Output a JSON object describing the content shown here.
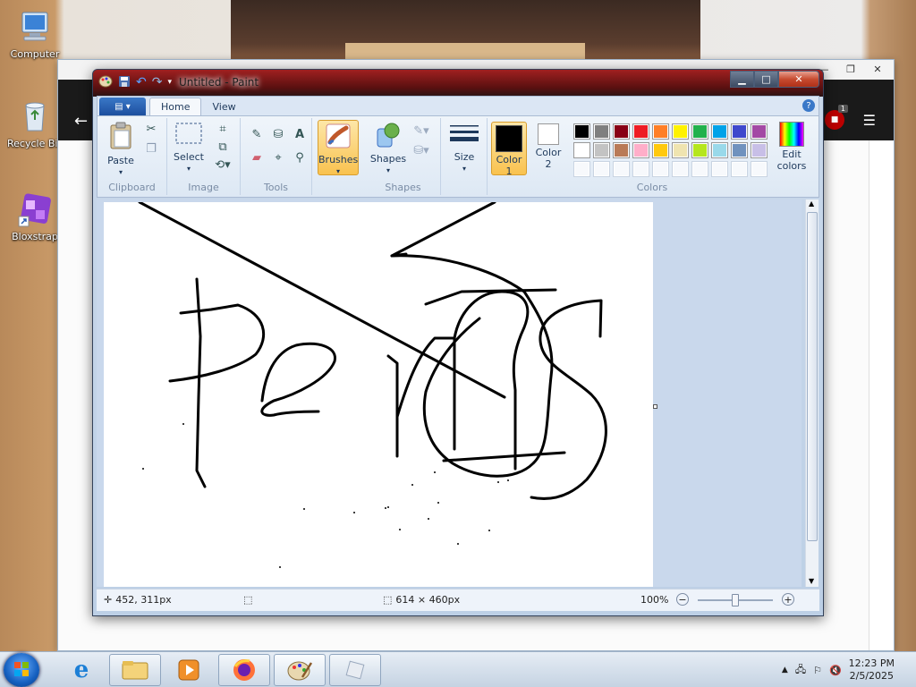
{
  "desktop": {
    "icons": [
      {
        "label": "Computer"
      },
      {
        "label": "Recycle Bin"
      },
      {
        "label": "Bloxstrap"
      }
    ]
  },
  "browser": {
    "extension_badge": "1"
  },
  "paint": {
    "title": "Untitled - Paint",
    "tabs": [
      "Home",
      "View"
    ],
    "groups": {
      "clipboard": {
        "label": "Clipboard",
        "paste": "Paste"
      },
      "image": {
        "label": "Image",
        "select": "Select"
      },
      "tools": {
        "label": "Tools"
      },
      "brushes": {
        "label": "Brushes"
      },
      "shapes": {
        "label": "Shapes",
        "shapes_btn": "Shapes"
      },
      "size": {
        "label": "Size"
      },
      "colors": {
        "label": "Colors",
        "color1": "Color\n1",
        "color2": "Color\n2",
        "edit_colors": "Edit\ncolors",
        "primary": "#000000",
        "secondary": "#ffffff",
        "palette_row1": [
          "#000000",
          "#7f7f7f",
          "#880015",
          "#ed1c24",
          "#ff7f27",
          "#fff200",
          "#22b14c",
          "#00a2e8",
          "#3f48cc",
          "#a349a4"
        ],
        "palette_row2": [
          "#ffffff",
          "#c3c3c3",
          "#b97a57",
          "#ffaec9",
          "#ffc90e",
          "#efe4b0",
          "#b5e61d",
          "#99d9ea",
          "#7092be",
          "#c8bfe7"
        ]
      }
    },
    "status": {
      "cursor_pos": "452, 311px",
      "canvas_size": "614 × 460px",
      "zoom": "100%"
    }
  },
  "taskbar": {
    "time": "12:23 PM",
    "date": "2/5/2025"
  }
}
